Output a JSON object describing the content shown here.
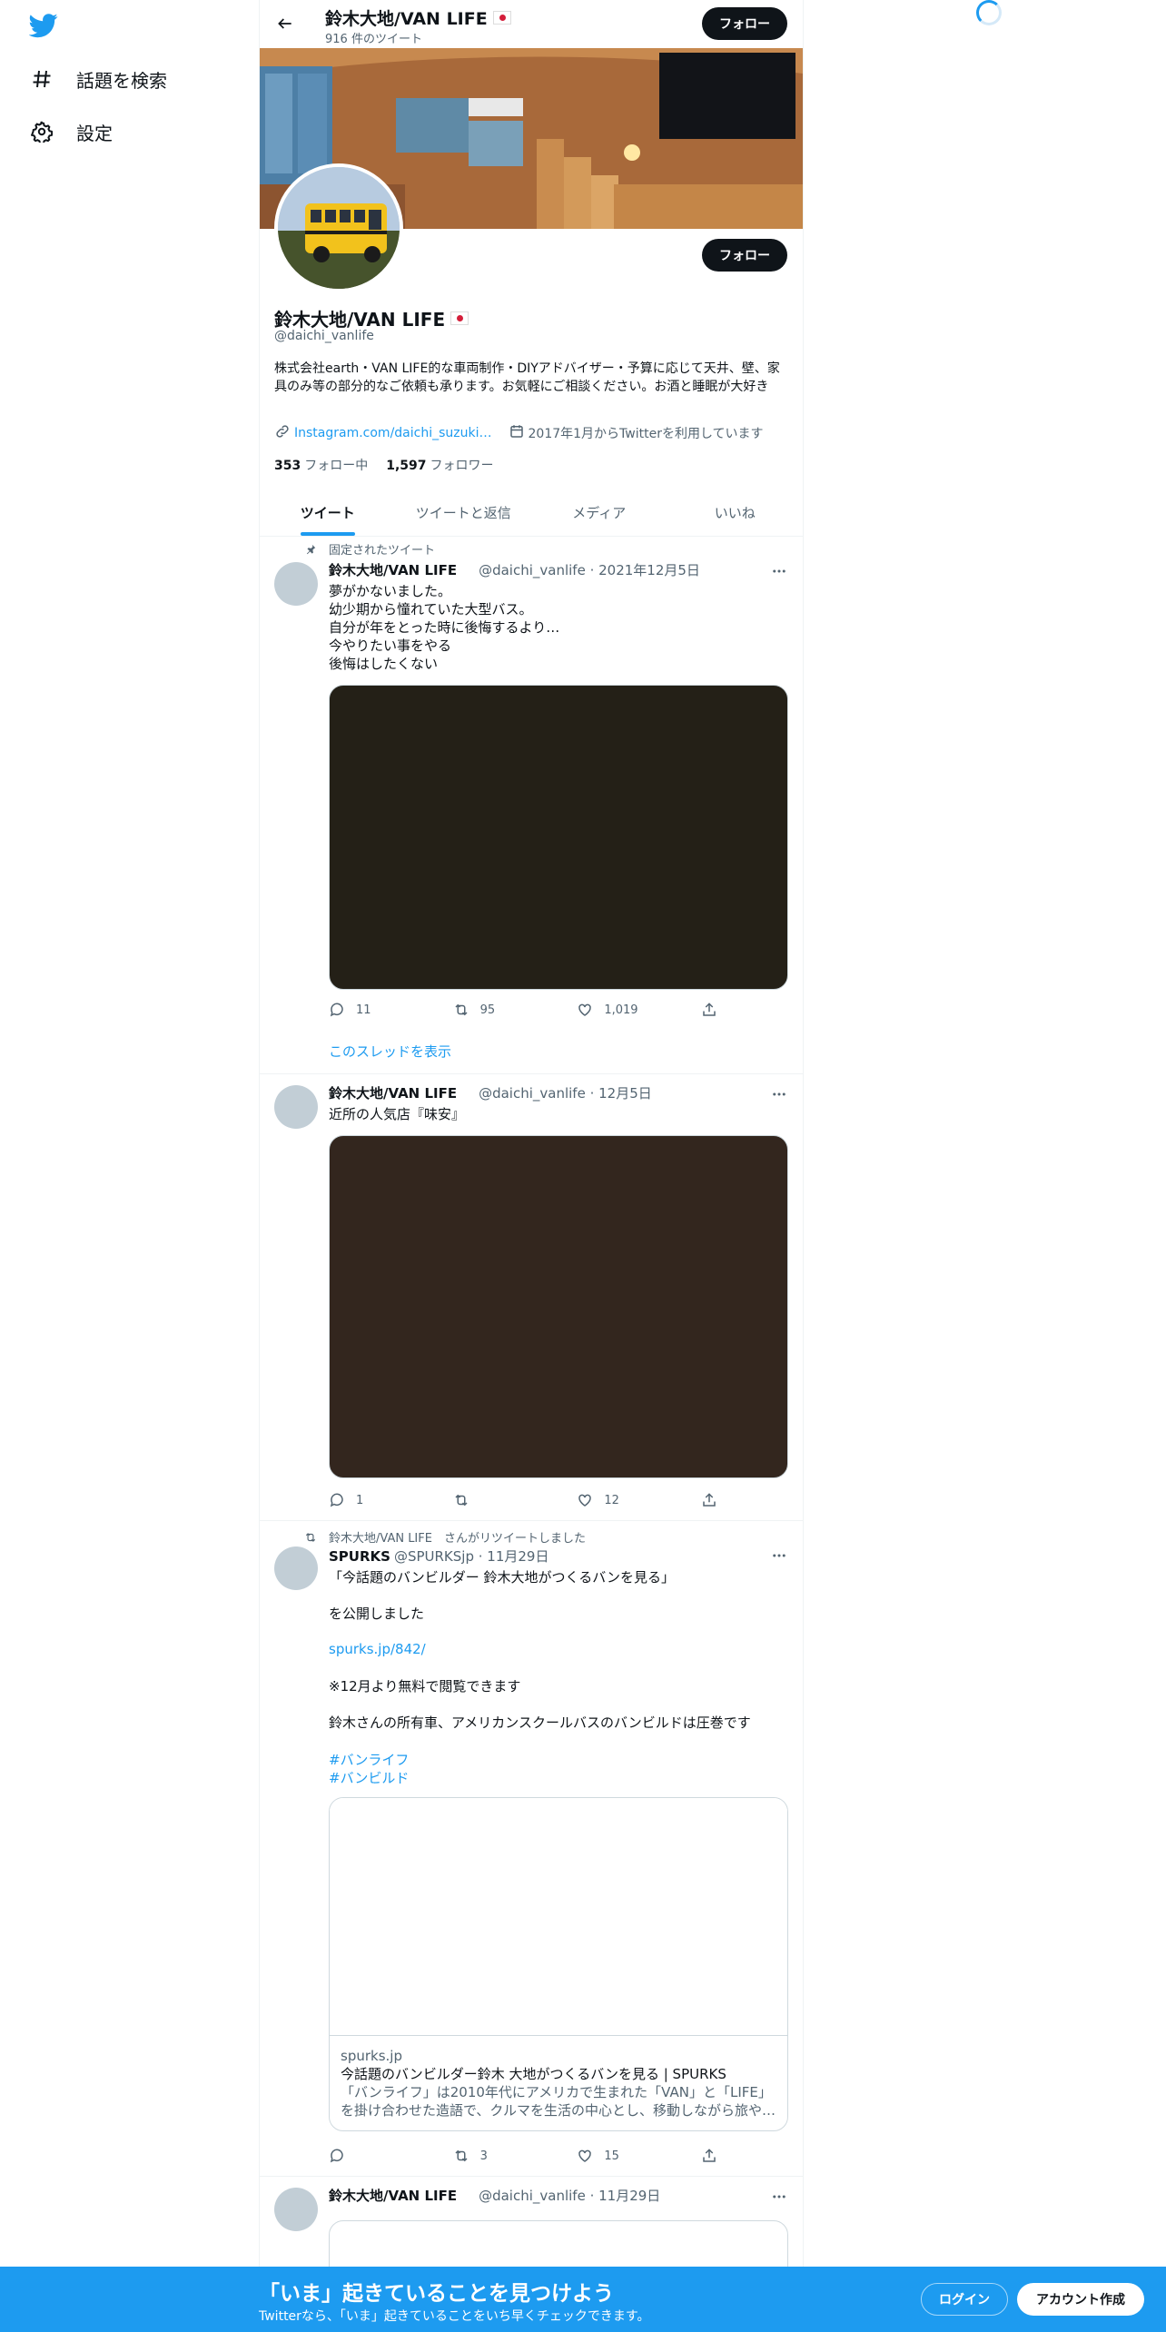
{
  "nav": {
    "explore_label": "話題を検索",
    "settings_label": "設定"
  },
  "header": {
    "name": "鈴木大地/VAN LIFE",
    "tweet_count": "916 件のツイート",
    "follow_label": "フォロー"
  },
  "profile": {
    "name": "鈴木大地/VAN LIFE",
    "handle": "@daichi_vanlife",
    "follow_label": "フォロー",
    "bio": "株式会社earth・VAN LIFE的な車両制作・DIYアドバイザー・予算に応じて天井、壁、家具のみ等の部分的なご依頼も承ります。お気軽にご相談ください。お酒と睡眠が大好き",
    "link": "Instagram.com/daichi_suzuki…",
    "joined": "2017年1月からTwitterを利用しています",
    "following_count": "353",
    "following_label": "フォロー中",
    "followers_count": "1,597",
    "followers_label": "フォロワー"
  },
  "tabs": [
    "ツイート",
    "ツイートと返信",
    "メディア",
    "いいね"
  ],
  "tweets": [
    {
      "context": "固定されたツイート",
      "name": "鈴木大地/VAN LIFE",
      "handle_time": "@daichi_vanlife · 2021年12月5日",
      "text": "夢がかないました。\n幼少期から憧れていた大型バス。\n自分が年をとった時に後悔するより…\n今やりたい事をやる\n後悔はしたくない",
      "replies": "11",
      "retweets": "95",
      "likes": "1,019",
      "thread_link": "このスレッドを表示",
      "media_color": "#242017"
    },
    {
      "name": "鈴木大地/VAN LIFE",
      "handle_time": "@daichi_vanlife · 12月5日",
      "text": "近所の人気店『味安』",
      "replies": "1",
      "retweets": "",
      "likes": "12",
      "media_color": "#33261e"
    },
    {
      "context": "鈴木大地/VAN LIFE　さんがリツイートしました",
      "name": "SPURKS",
      "handle_time": "@SPURKSjp · 11月29日",
      "text1": "「今話題のバンビルダー 鈴木大地がつくるバンを見る」\n\nを公開しました",
      "url": "spurks.jp/842/",
      "text2": "※12月より無料で閲覧できます\n\n鈴木さんの所有車、アメリカンスクールバスのバンビルドは圧巻です",
      "hashtag1": "#バンライフ",
      "hashtag2": "#バンビルド",
      "card_domain": "spurks.jp",
      "card_title": "今話題のバンビルダー鈴木 大地がつくるバンを見る | SPURKS",
      "card_desc": "「バンライフ」は2010年代にアメリカで生まれた「VAN」と「LIFE」を掛け合わせた造語で、クルマを生活の中心とし、移動しながら旅や…",
      "replies": "",
      "retweets": "3",
      "likes": "15"
    },
    {
      "name": "鈴木大地/VAN LIFE",
      "handle_time": "@daichi_vanlife · 11月29日"
    }
  ],
  "bottom_bar": {
    "title": "「いま」起きていることを見つけよう",
    "subtitle": "Twitterなら、「いま」起きていることをいち早くチェックできます。",
    "login_label": "ログイン",
    "signup_label": "アカウント作成"
  },
  "colors": {
    "accent": "#1d9bf0",
    "text": "#0f1419",
    "secondary": "#536471"
  }
}
